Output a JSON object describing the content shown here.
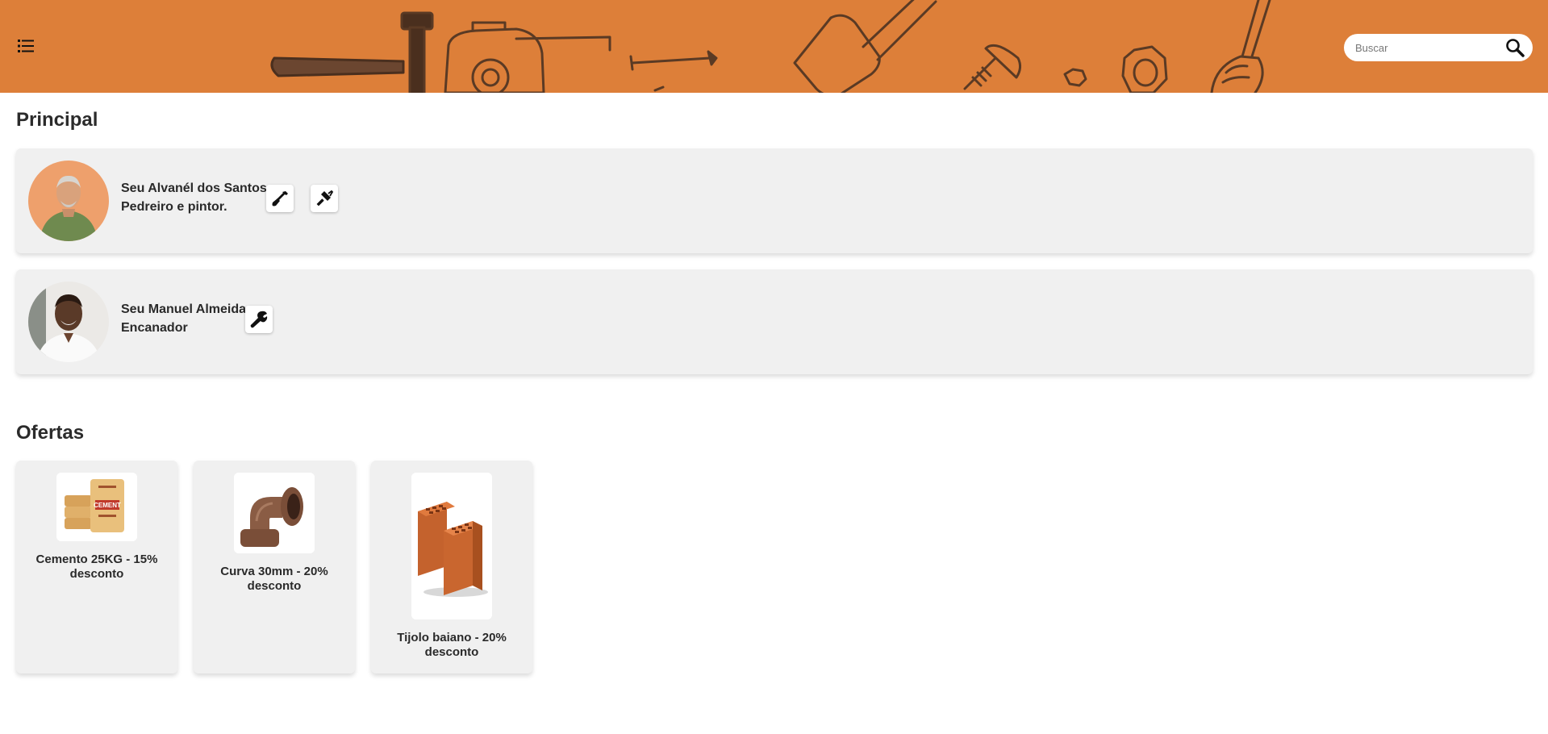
{
  "header": {
    "menu_icon": "list-menu-icon",
    "background_color": "#dd7f39",
    "search": {
      "placeholder": "Buscar",
      "value": "",
      "icon": "search-icon"
    }
  },
  "principal": {
    "title": "Principal",
    "workers": [
      {
        "name": "Seu Alvanél dos Santos",
        "role": "Pedreiro e pintor.",
        "tools": [
          "shovel-icon",
          "paint-roller-icon"
        ]
      },
      {
        "name": "Seu Manuel Almeida",
        "role": "Encanador",
        "tools": [
          "wrench-icon"
        ]
      }
    ]
  },
  "ofertas": {
    "title": "Ofertas",
    "items": [
      {
        "label": "Cemento 25KG - 15% desconto",
        "image": "cement-bags-image"
      },
      {
        "label": "Curva 30mm - 20% desconto",
        "image": "pipe-elbow-image"
      },
      {
        "label": "Tijolo baiano - 20% desconto",
        "image": "clay-bricks-image"
      }
    ]
  },
  "colors": {
    "accent": "#dd7f39",
    "card_bg": "#f0f0f0",
    "text": "#2a2a2a"
  }
}
